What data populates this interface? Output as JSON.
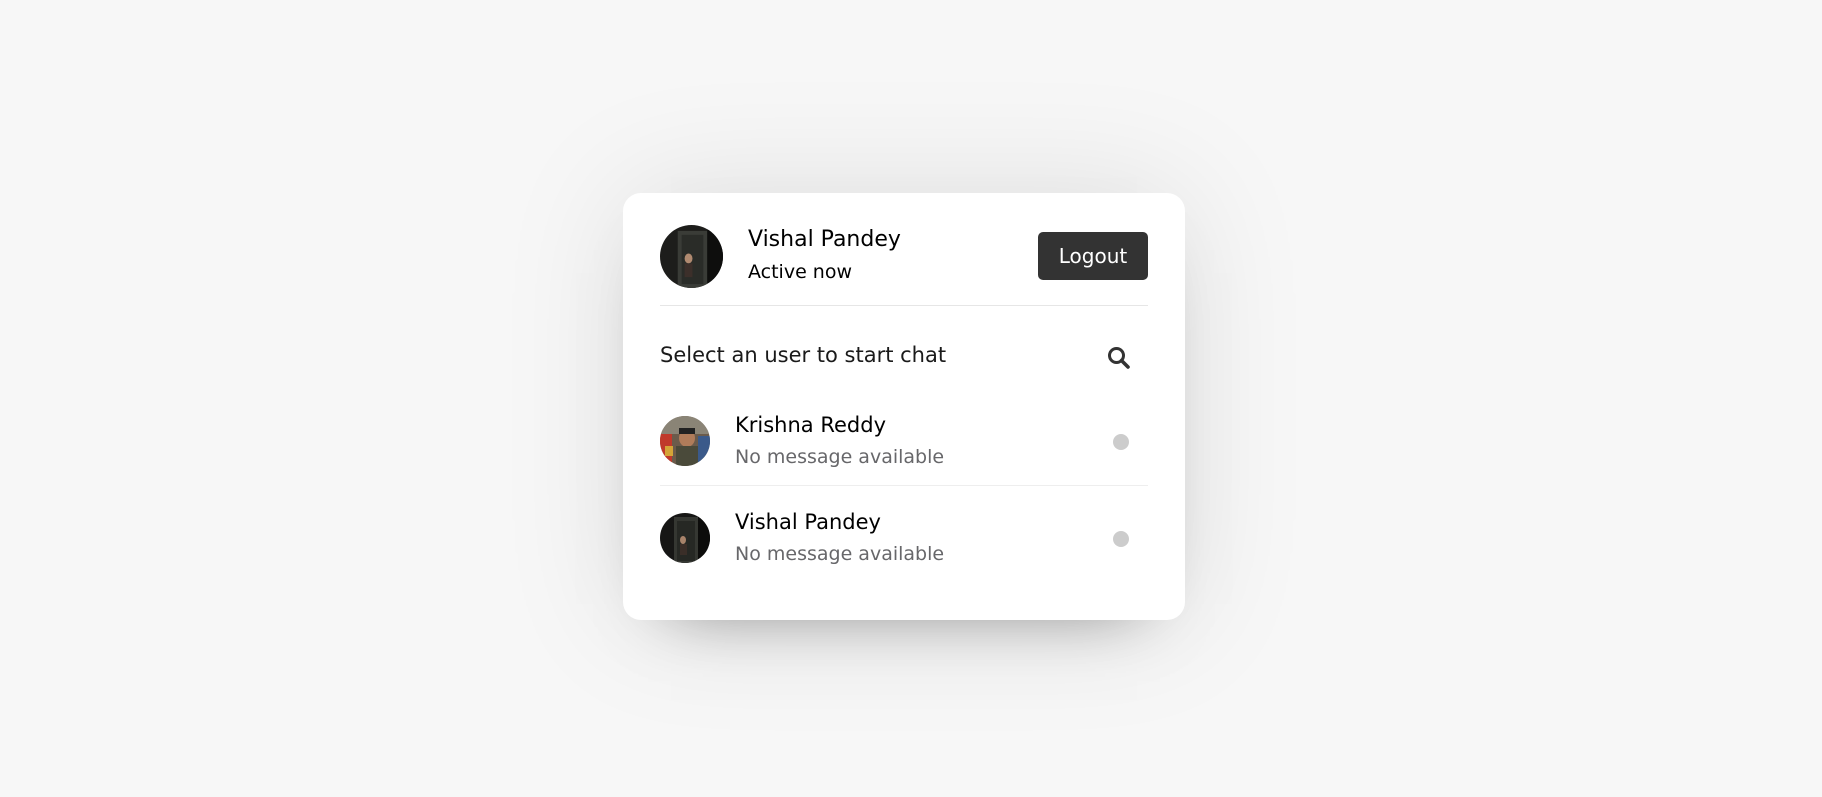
{
  "current_user": {
    "name": "Vishal Pandey",
    "status": "Active now",
    "avatar_icon": "user-photo-icon"
  },
  "header": {
    "logout_label": "Logout"
  },
  "search": {
    "prompt": "Select an user to start chat",
    "icon": "search-icon"
  },
  "users": [
    {
      "name": "Krishna Reddy",
      "message": "No message available",
      "status_color": "#cccccc",
      "avatar_icon": "user-photo-icon"
    },
    {
      "name": "Vishal Pandey",
      "message": "No message available",
      "status_color": "#cccccc",
      "avatar_icon": "user-photo-icon"
    }
  ],
  "colors": {
    "button_bg": "#333333",
    "page_bg": "#f7f7f7",
    "offline_dot": "#cccccc"
  }
}
